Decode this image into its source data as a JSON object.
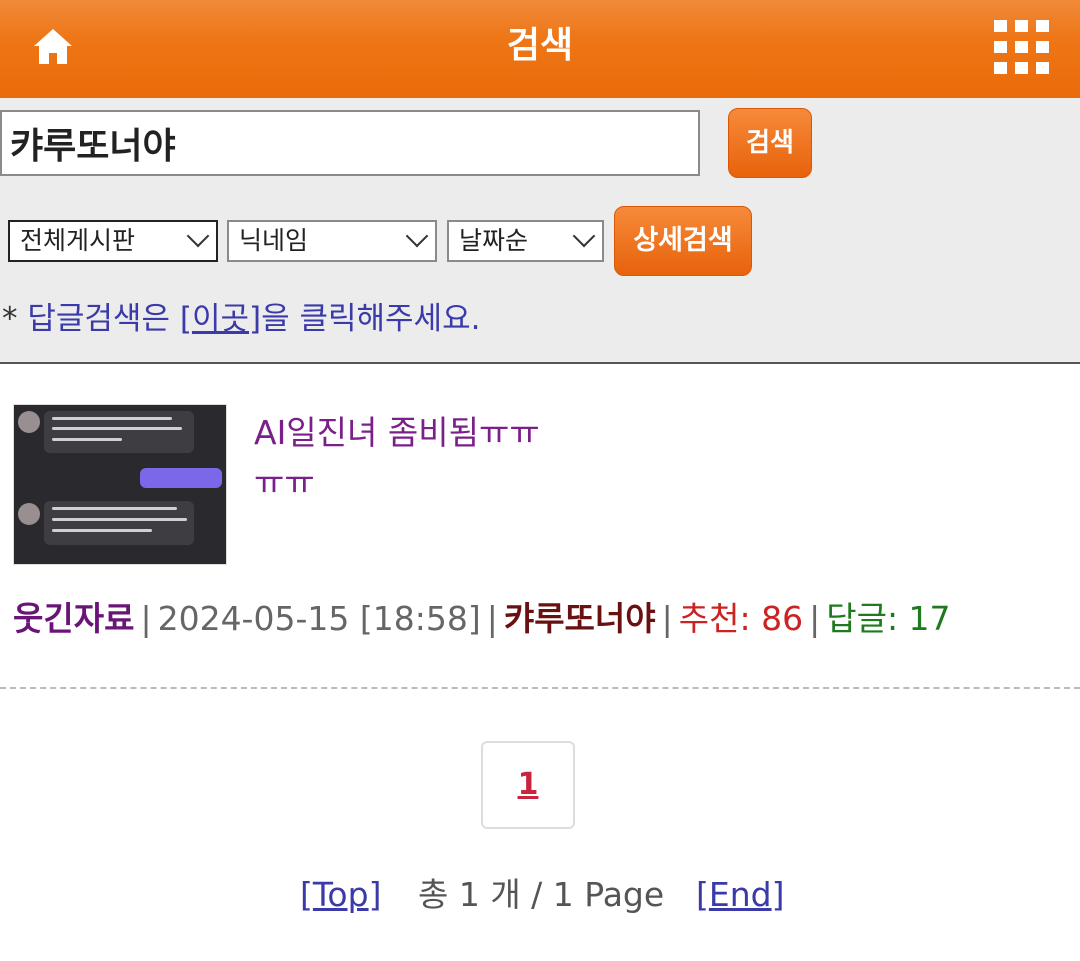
{
  "header": {
    "title": "검색",
    "home_icon": "home-icon",
    "menu_icon": "grid-menu-icon"
  },
  "search": {
    "query": "캬루또너야",
    "button_label": "검색",
    "board_select": "전체게시판",
    "field_select": "닉네임",
    "order_select": "날짜순",
    "detail_button_label": "상세검색",
    "hint_prefix": "* ",
    "hint_text_1": "답글검색은 ",
    "hint_link_open": "[",
    "hint_link": "이곳",
    "hint_link_close": "]",
    "hint_text_2": "을 클릭해주세요."
  },
  "result": {
    "title_line1": "AI일진녀 좀비됨ㅠㅠ",
    "title_line2": "ㅠㅠ",
    "category": "웃긴자료",
    "date": "2024-05-15 [18:58]",
    "author": "캬루또너야",
    "recommend_label": "추천: 86",
    "reply_label": "답글: 17",
    "separator": "|"
  },
  "pagination": {
    "current_page": "1",
    "top_link": "Top",
    "end_link": "End",
    "bracket_open": "[",
    "bracket_close": "]",
    "total_text": "총 1 개 / 1 Page"
  },
  "colors": {
    "header_orange": "#ee7616",
    "button_orange": "#e8620b",
    "link_blue": "#3a3aa8",
    "title_purple": "#7b1f8a",
    "recommend_red": "#cc2222",
    "reply_green": "#1f7a1f"
  }
}
